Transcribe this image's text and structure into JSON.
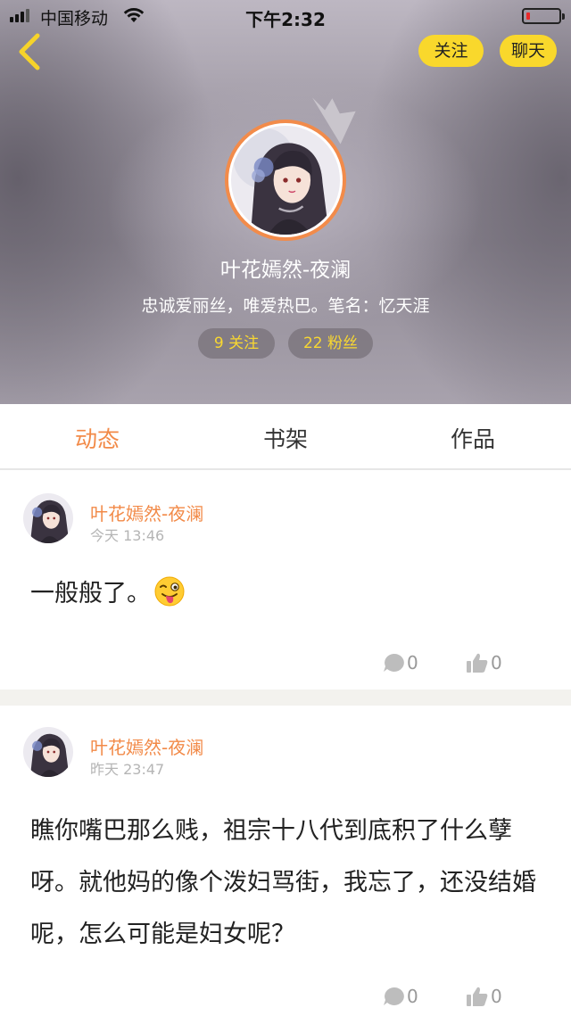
{
  "status_bar": {
    "carrier": "中国移动",
    "time": "下午2:32",
    "battery_color": "#e82a2a"
  },
  "header": {
    "follow_label": "关注",
    "chat_label": "聊天",
    "nickname": "叶花嫣然-夜澜",
    "bio": "忠诚爱丽丝，唯爱热巴。笔名：忆天涯",
    "following": "9 关注",
    "fans": "22 粉丝"
  },
  "tabs": [
    {
      "label": "动态",
      "active": true
    },
    {
      "label": "书架",
      "active": false
    },
    {
      "label": "作品",
      "active": false
    }
  ],
  "posts": [
    {
      "author": "叶花嫣然-夜澜",
      "time": "今天 13:46",
      "text": "一般般了。",
      "emoji_icon": "winking-tongue-emoji",
      "comments": "0",
      "likes": "0"
    },
    {
      "author": "叶花嫣然-夜澜",
      "time": "昨天 23:47",
      "text": "瞧你嘴巴那么贱，祖宗十八代到底积了什么孽呀。就他妈的像个泼妇骂街，我忘了，还没结婚呢，怎么可能是妇女呢？",
      "comments": "0",
      "likes": "0"
    }
  ],
  "colors": {
    "accent": "#f28a48",
    "yellow": "#f9d82c",
    "stat_text": "#f8d731"
  }
}
